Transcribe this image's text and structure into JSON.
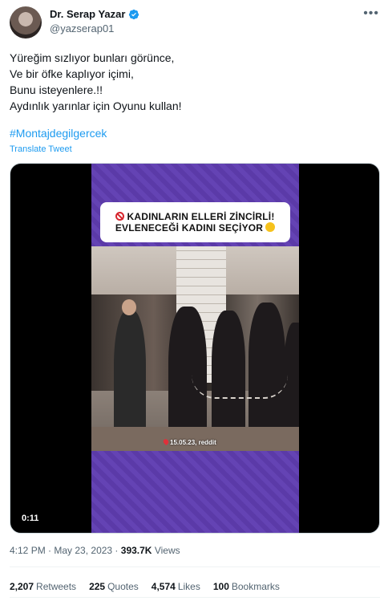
{
  "author": {
    "display_name": "Dr. Serap Yazar",
    "handle": "@yazserap01",
    "verified": true,
    "verified_color": "#1d9bf0"
  },
  "tweet": {
    "lines": [
      "Yüreğim sızlıyor bunları görünce,",
      "Ve bir öfke kaplıyor içimi,",
      "Bunu isteyenlere.!!",
      "Aydınlık yarınlar için Oyunu kullan!"
    ],
    "hashtag": "#Montajdegilgercek",
    "translate_label": "Translate Tweet"
  },
  "media": {
    "caption_line1": "KADINLARIN ELLERİ ZİNCİRLİ!",
    "caption_line2": "EVLENECEĞİ KADINI SEÇİYOR",
    "location_tag": "15.05.23, reddit",
    "duration": "0:11",
    "icons": [
      "no-entry-icon",
      "grimacing-emoji-icon",
      "location-pin-icon"
    ],
    "frame_color": "#5b3aa8"
  },
  "meta": {
    "time": "4:12 PM",
    "date": "May 23, 2023",
    "views_count": "393.7K",
    "views_label": "Views"
  },
  "stats": {
    "retweets_count": "2,207",
    "retweets_label": "Retweets",
    "quotes_count": "225",
    "quotes_label": "Quotes",
    "likes_count": "4,574",
    "likes_label": "Likes",
    "bookmarks_count": "100",
    "bookmarks_label": "Bookmarks"
  },
  "colors": {
    "accent": "#1d9bf0",
    "muted": "#536471",
    "text": "#0f1419"
  }
}
